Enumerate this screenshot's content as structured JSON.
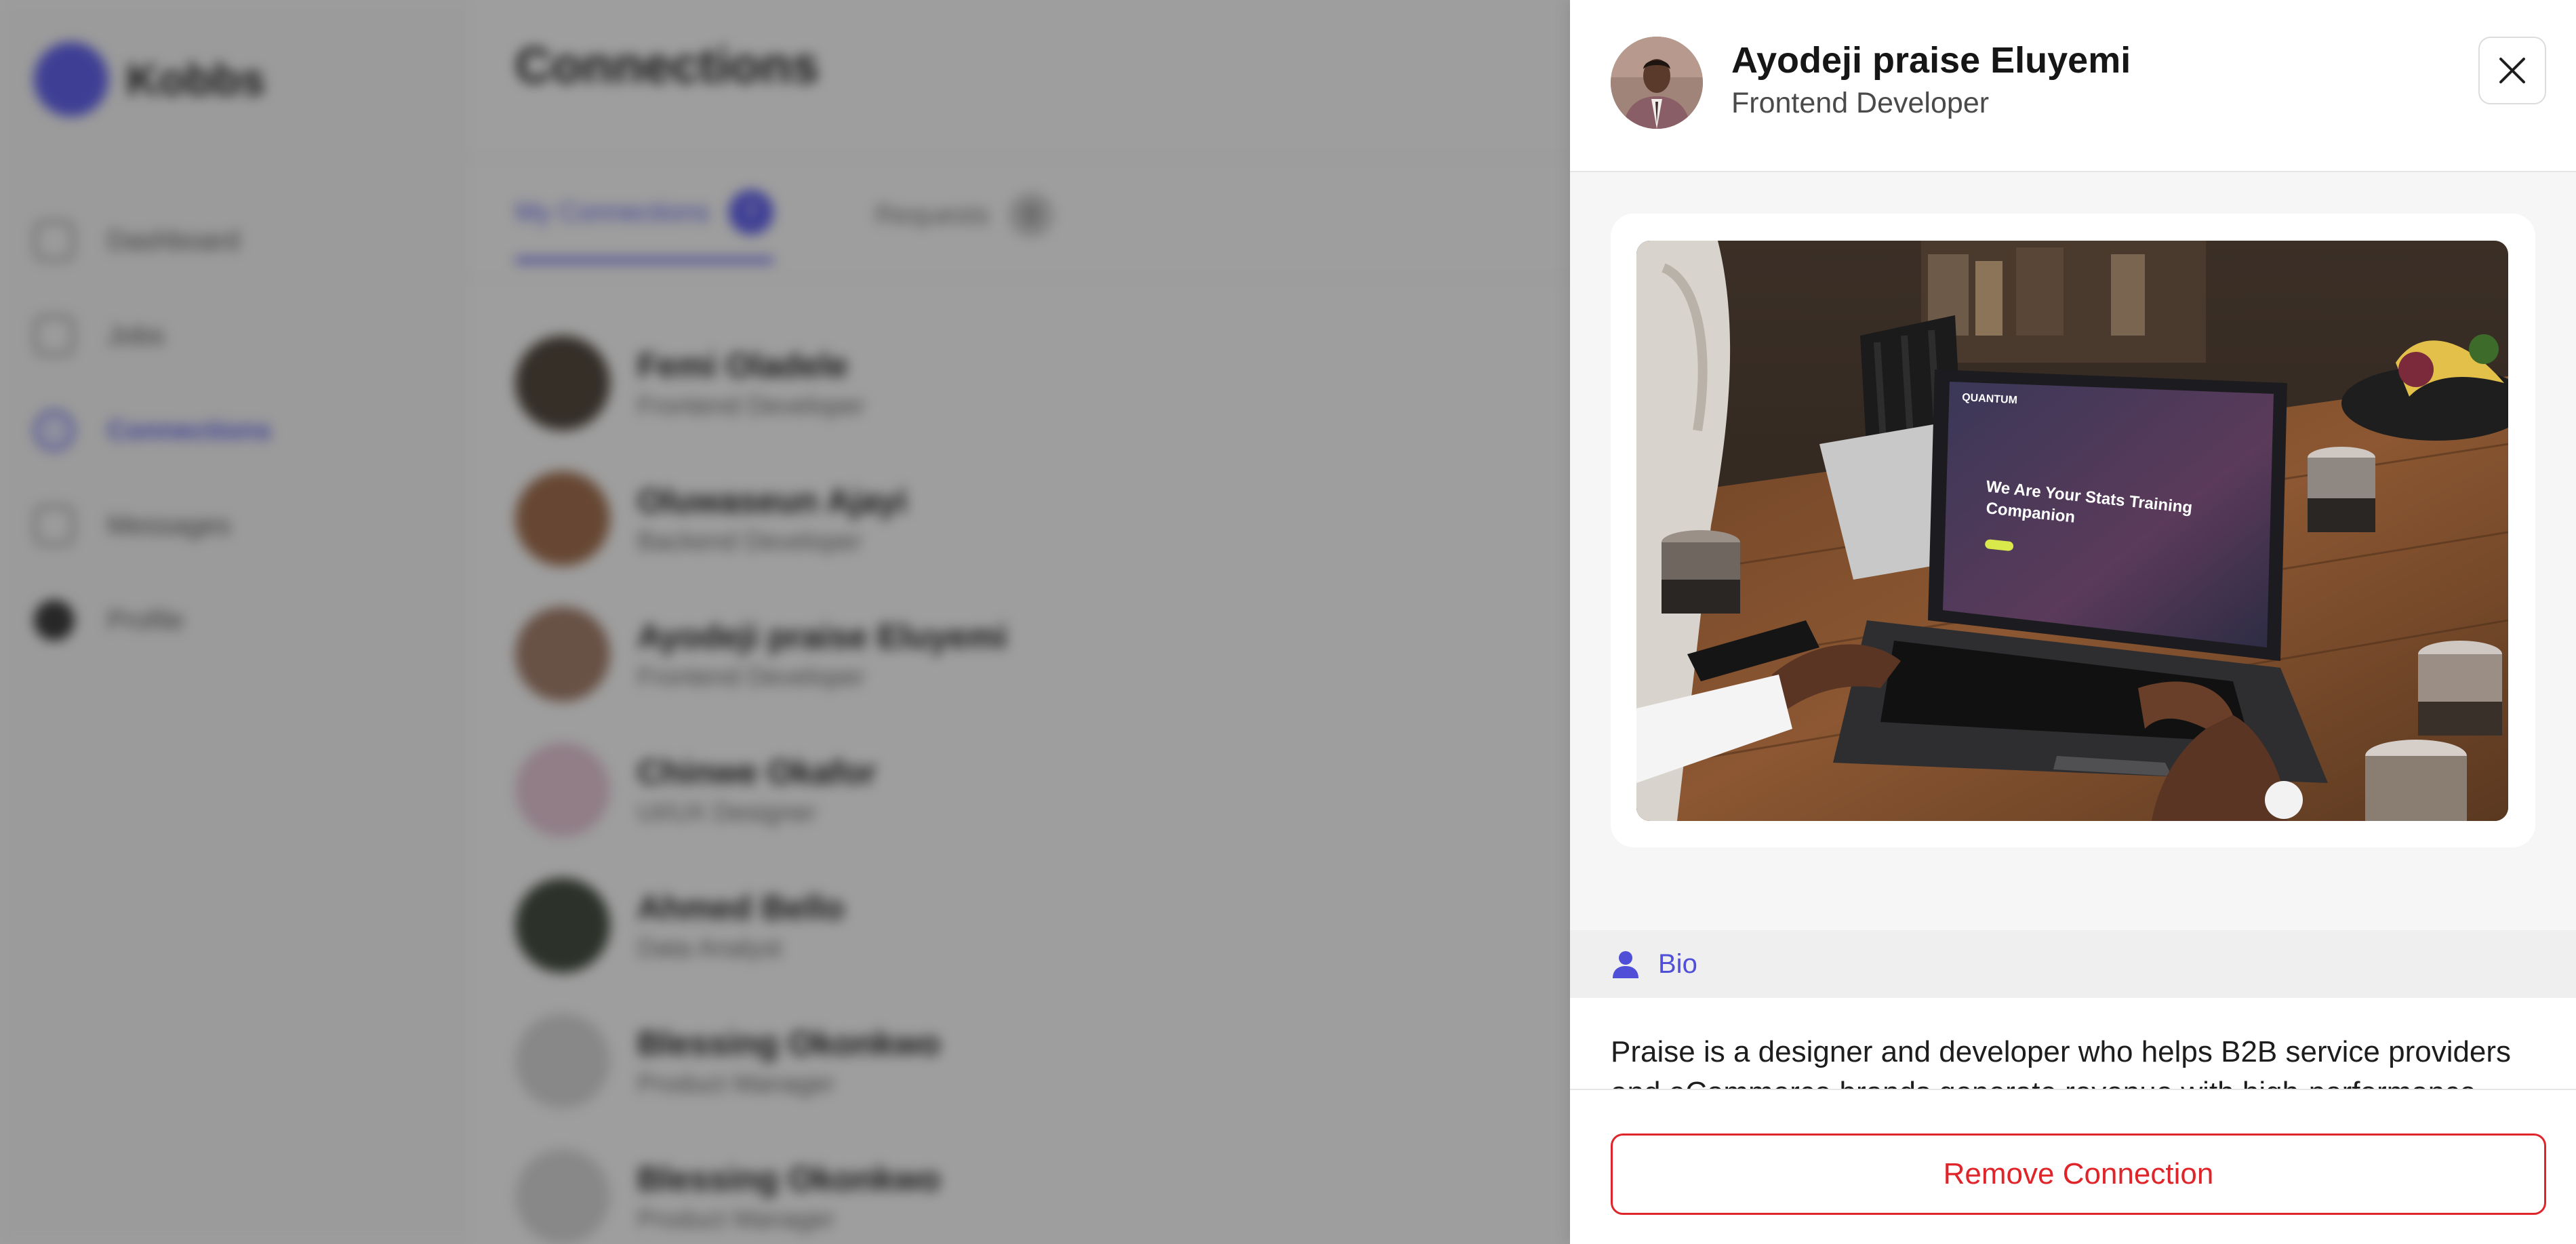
{
  "background": {
    "brand_name": "Kobbs",
    "nav_items": [
      "Dashboard",
      "Jobs",
      "Connections",
      "Messages",
      "Profile"
    ],
    "page_title": "Connections",
    "tabs": [
      {
        "label": "My Connections",
        "count": "7"
      },
      {
        "label": "Requests",
        "count": "0"
      }
    ],
    "connections": [
      {
        "name": "Femi Oladele",
        "role": "Frontend Developer"
      },
      {
        "name": "Oluwaseun Ajayi",
        "role": "Backend Developer"
      },
      {
        "name": "Ayodeji praise Eluyemi",
        "role": "Frontend Developer"
      },
      {
        "name": "Chinwe Okafor",
        "role": "UI/UX Designer"
      },
      {
        "name": "Ahmed Bello",
        "role": "Data Analyst"
      },
      {
        "name": "Blessing Okonkwo",
        "role": "Product Manager"
      },
      {
        "name": "Blessing Okonkwo",
        "role": "Product Manager"
      }
    ]
  },
  "panel": {
    "name": "Ayodeji praise Eluyemi",
    "role": "Frontend Developer",
    "close_icon": "close-icon",
    "media_alt": "Laptop on a wooden table showing a website with the headline We Are Your Stats Training Companion",
    "media_headline": "We Are Your Stats Training Companion",
    "media_logo": "QUANTUM",
    "bio_label": "Bio",
    "bio_icon": "user-icon",
    "bio_text": "Praise is a designer and developer who helps B2B service providers and eCommerce brands generate revenue with high-performance websites.",
    "remove_button": "Remove Connection"
  },
  "colors": {
    "accent": "#5b5bf0",
    "danger": "#e0252a",
    "overlay": "rgba(25,25,25,0.42)"
  }
}
